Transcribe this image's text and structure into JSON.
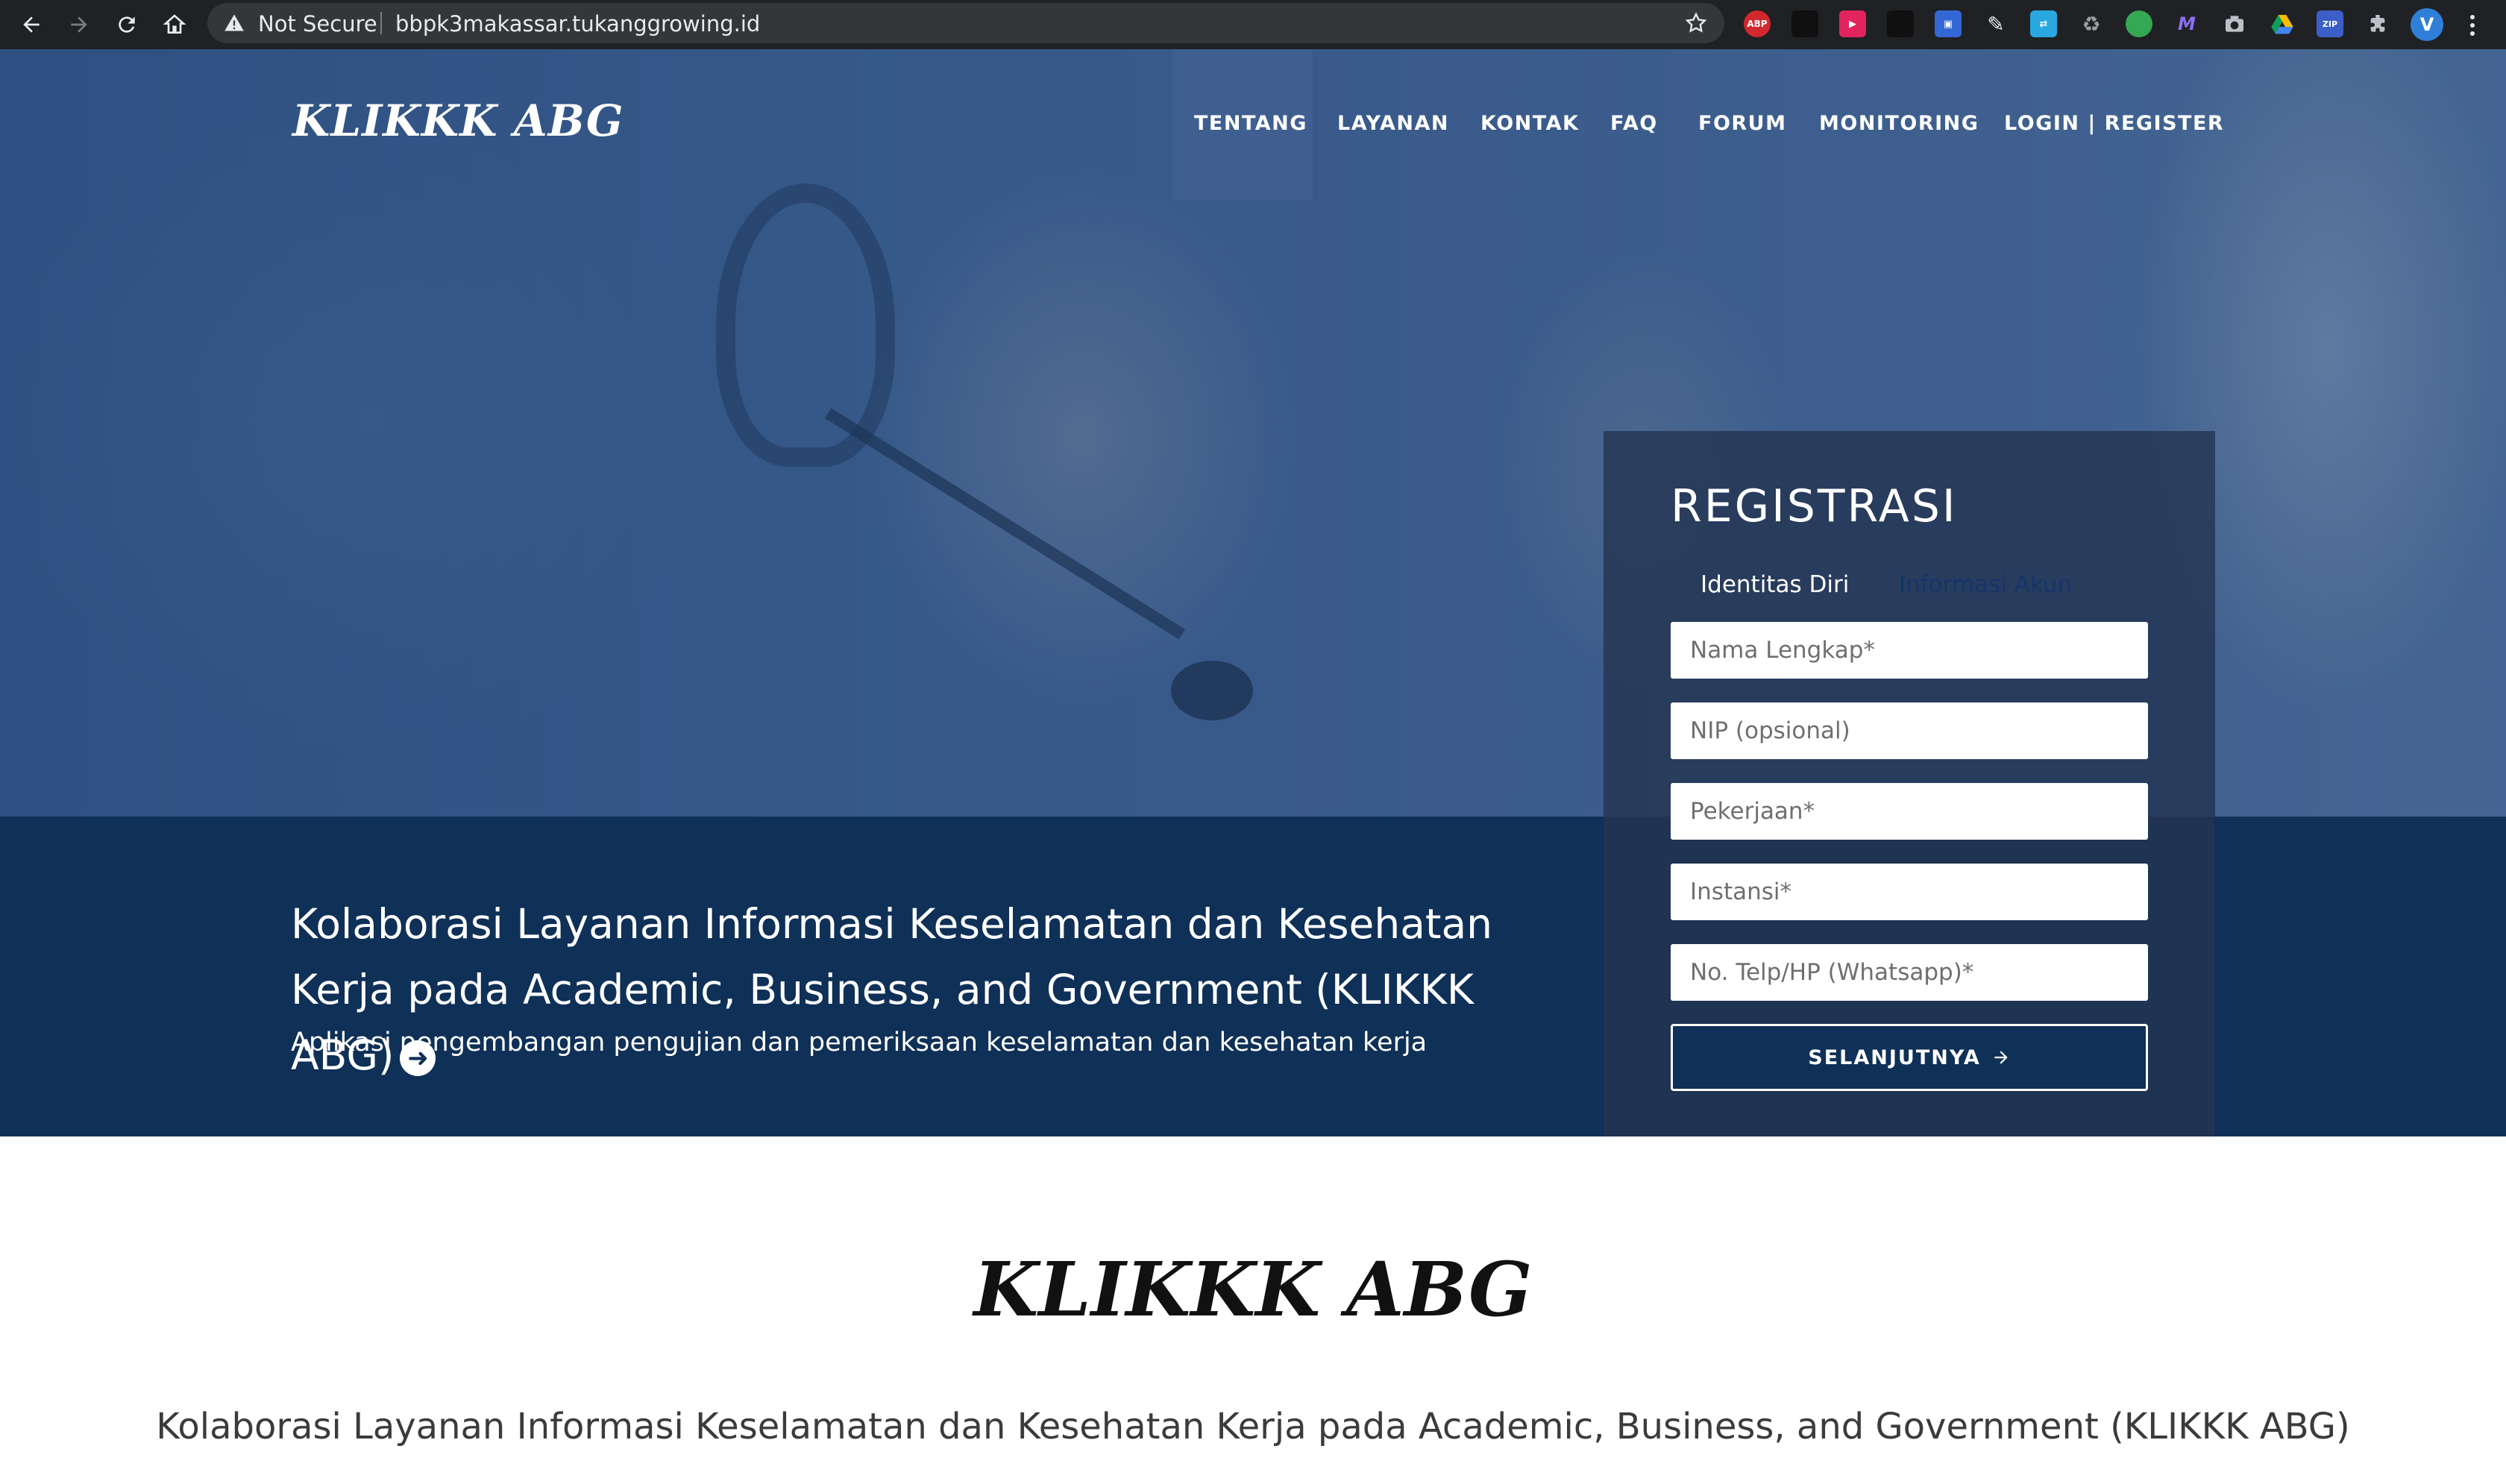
{
  "browser": {
    "not_secure": "Not Secure",
    "url": "bbpk3makassar.tukanggrowing.id",
    "profile_initial": "V",
    "extensions": [
      "adblock-plus",
      "dark-extension",
      "red-extension",
      "blue-extension",
      "pen-extension",
      "translate-extension",
      "recycle-extension",
      "green-extension",
      "m-extension",
      "camera-extension",
      "drive-extension",
      "zip-extension",
      "puzzle-extension"
    ],
    "ext_labels": {
      "abp": "ABP",
      "zip": "ZIP",
      "m": "M"
    }
  },
  "site": {
    "logo": "KLIKKK ABG",
    "menu": [
      "TENTANG",
      "LAYANAN",
      "KONTAK",
      "FAQ",
      "FORUM",
      "MONITORING",
      "LOGIN | REGISTER"
    ]
  },
  "hero": {
    "title": "Kolaborasi Layanan Informasi Keselamatan dan Kesehatan Kerja pada Academic, Business, and Government (KLIKKK ABG)",
    "title_icon": "arrow-circle-right",
    "subtitle": "Aplikasi pengembangan pengujian dan pemeriksaan keselamatan dan kesehatan kerja"
  },
  "registration": {
    "title": "REGISTRASI",
    "tabs": [
      "Identitas Diri",
      "Informasi Akun"
    ],
    "active_tab": "Identitas Diri",
    "fields": {
      "name_placeholder": "Nama Lengkap*",
      "nip_placeholder": "NIP (opsional)",
      "job_placeholder": "Pekerjaan*",
      "institution_placeholder": "Instansi*",
      "phone_placeholder": "No. Telp/HP (Whatsapp)*"
    },
    "submit_label": "SELANJUTNYA",
    "submit_icon": "arrow-right"
  },
  "about": {
    "logo": "KLIKKK ABG",
    "text": "Kolaborasi Layanan Informasi Keselamatan dan Kesehatan Kerja pada Academic, Business, and Government (KLIKKK ABG)"
  },
  "colors": {
    "navy": "#0f3057",
    "chrome_bg": "#202124",
    "omnibox_bg": "#35363a",
    "inactive_tab": "#15356b"
  }
}
